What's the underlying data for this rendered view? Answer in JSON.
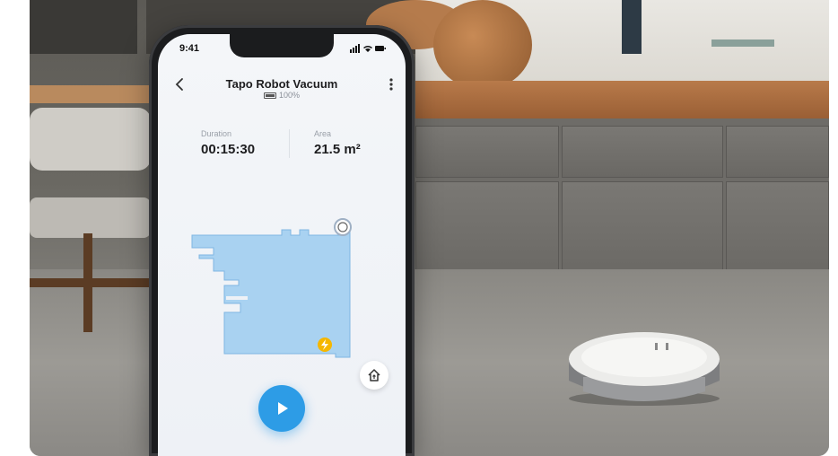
{
  "status_bar": {
    "time": "9:41"
  },
  "header": {
    "title": "Tapo Robot Vacuum",
    "battery_percent": "100%"
  },
  "stats": {
    "duration": {
      "label": "Duration",
      "value": "00:15:30"
    },
    "area": {
      "label": "Area",
      "value": "21.5 m²"
    }
  },
  "icons": {
    "back": "chevron-left-icon",
    "more": "more-vertical-icon",
    "home": "home-icon",
    "play": "play-icon",
    "charging_dock": "lightning-icon",
    "robot_position": "robot-icon"
  },
  "colors": {
    "map_fill": "#a9d2f1",
    "map_stroke": "#7fb6e2",
    "play_button": "#2d9ce6",
    "dock": "#f5b700"
  }
}
